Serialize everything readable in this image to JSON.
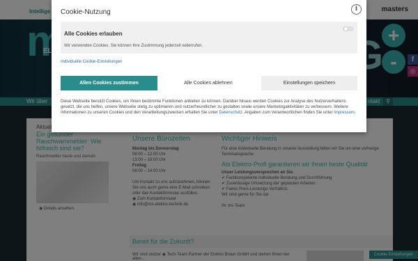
{
  "background": {
    "tagline": "Intellige",
    "top_right": "masters",
    "hero": {
      "logo": "m",
      "logo_sub": "EL",
      "right_letter": "G",
      "plus1": "+",
      "plus2": "-"
    },
    "social": {
      "facebook": "f",
      "instagram": "◎"
    },
    "nav": {
      "left_text": "Wir über",
      "right_text": "ntakt",
      "search_icon": "⚲"
    },
    "left_card": {
      "label": "Aktuel",
      "headline": "Ein gesunder Rauchwarnmelder: Wie hilfreich sind sie?",
      "subtext": "Rauchmelder heute und damals",
      "link": "◉ Details ansehen"
    },
    "hours": {
      "title": "Unsere Bürozeiten",
      "weekdays_label": "Montag bis Donnerstag",
      "weekdays_am": "08:00 – 12:00 Uhr",
      "weekdays_pm": "13:00 – 16:00 Uhr",
      "friday_label": "Freitag",
      "friday_time": "08:00 – 14:00 Uhr",
      "contact_text": "Um Kontakt zu uns aufzunehmen, können Sie uns auch gerne eine E-Mail schreiben oder das Kontaktformular ausfüllen.",
      "form_link": "◉ Zum Kontaktformular",
      "email_link": "◉ info@ms-elektro-technik.de"
    },
    "info": {
      "title": "Wichtiger Hinweis",
      "text": "Für eine individuelle Beratung in unserer Ausstellung bitten wir Sie um eine vorherige Terminabsprache",
      "subtitle": "Als Elektro-Profi garantieren wir Ihnen beste Qualität",
      "promise_title": "Unser Leistungsversprechen an Sie.",
      "promise_1": "✔ Fachkompetente individuelle Beratung und Durchführung",
      "promise_2": "✔ Zuverlässige Umsetzung der geplanten Arbeiten",
      "promise_3": "✔ Faires Preis-Leistungs-Verhältnis",
      "closing": "Wir sind gerne für Sie da!",
      "sign": "Ihr ms-Team"
    },
    "band": {
      "title": "Bereit für die Zukunft?",
      "text": "Wir sind stolzer ◉ Tech-Team Partner der Elektro Braun GmbH und stehen Ihnen bei allen..."
    },
    "cookie_settings_button": "Cookie-Einstellungen"
  },
  "modal": {
    "title": "Cookie-Nutzung",
    "info_icon": "i",
    "all_cookies": {
      "title": "Alle Cookies erlauben",
      "text": "Wir verwenden Cookies. Sie können Ihre Zustimmung jederzeit widerrufen."
    },
    "individual_link": "Individuelle Cookie-Einstellungen",
    "buttons": {
      "accept": "Allen Cookies zustimmen",
      "reject": "Alle Cookies ablehnen",
      "save": "Einstellungen speichern"
    },
    "description_before": "Diese Webseite benutzt Cookies, um Ihnen bestimmte Funktionen anbieten zu können. Darüber hinaus werden Cookies zur Analyse des Nutzerverhaltens gesetzt, die uns helfen, unsere Webseite stetig zu optimieren und nutzerfreundlicher zu gestalten sowie unsere Marketingaktivitäten zu verbessern. Weitere Informationen zu unseren Cookies und den Verarbeitungszwecken erhalten Sie unter ",
    "privacy_link": "Datenschutz",
    "description_middle": ". Angaben zum Verantwortlichen finden Sie unter ",
    "imprint_link": "Impressum",
    "description_end": ".",
    "colors": {
      "accent": "#2a8d8d",
      "link": "#2a6f9e",
      "overlay": "rgba(0,0,0,0.5)"
    }
  }
}
